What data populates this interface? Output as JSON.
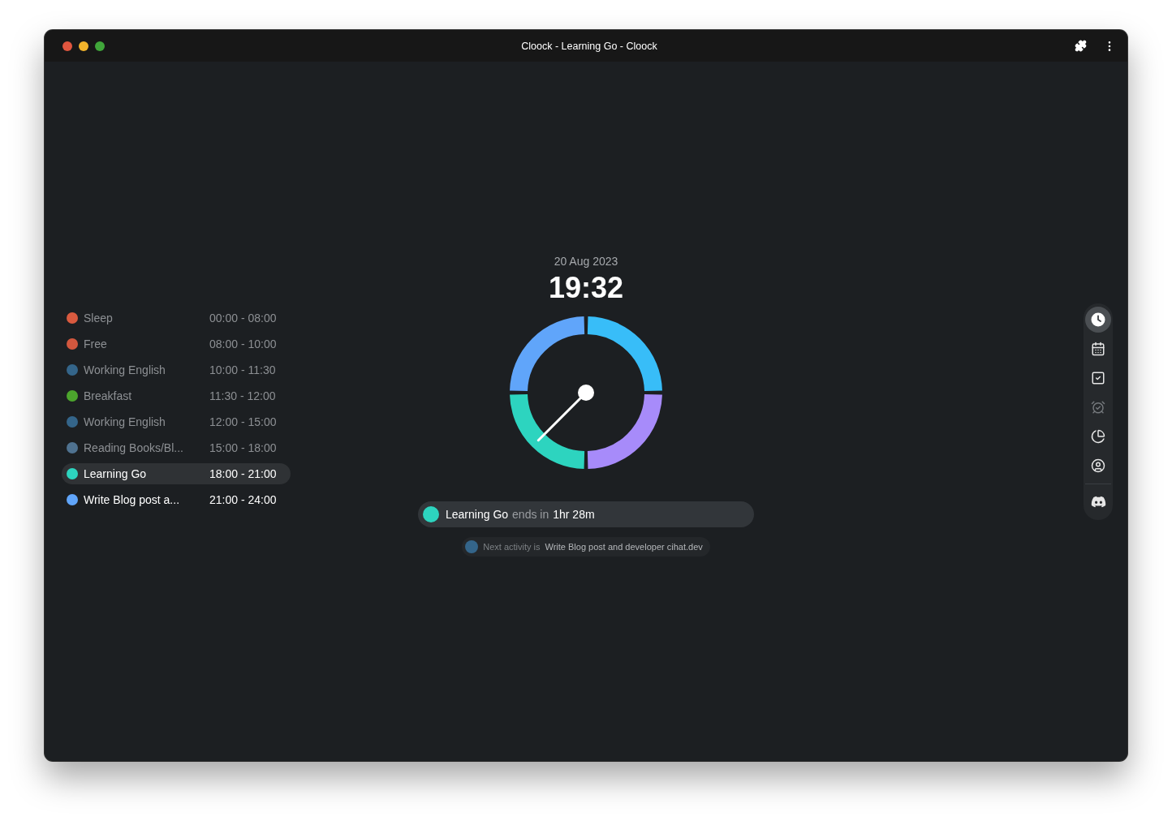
{
  "window": {
    "title": "Cloock - Learning Go - Cloock"
  },
  "activities": [
    {
      "name": "Sleep",
      "time": "00:00 - 08:00",
      "color": "#d95a3f",
      "done": true,
      "selected": false
    },
    {
      "name": "Free",
      "time": "08:00 - 10:00",
      "color": "#d2573e",
      "done": true,
      "selected": false
    },
    {
      "name": "Working English",
      "time": "10:00 - 11:30",
      "color": "#34658a",
      "done": true,
      "selected": false
    },
    {
      "name": "Breakfast",
      "time": "11:30 - 12:00",
      "color": "#4ca52d",
      "done": true,
      "selected": false
    },
    {
      "name": "Working English",
      "time": "12:00 - 15:00",
      "color": "#34658a",
      "done": true,
      "selected": false
    },
    {
      "name": "Reading Books/Bl...",
      "time": "15:00 - 18:00",
      "color": "#4f7290",
      "done": true,
      "selected": false
    },
    {
      "name": "Learning Go",
      "time": "18:00 - 21:00",
      "color": "#2dd4bf",
      "done": false,
      "selected": true
    },
    {
      "name": "Write Blog post a...",
      "time": "21:00 - 24:00",
      "color": "#60a5fa",
      "done": false,
      "selected": false
    }
  ],
  "clock": {
    "date": "20 Aug 2023",
    "time": "19:32"
  },
  "status": {
    "activity": "Learning Go",
    "connector": "ends in",
    "remaining": "1hr 28m",
    "color": "#2dd4bf"
  },
  "next": {
    "label": "Next activity is",
    "activity": "Write Blog post and developer cihat.dev",
    "color": "#34658a"
  },
  "nav": [
    {
      "kind": "clock",
      "selected": true,
      "disabled": false
    },
    {
      "kind": "calendar",
      "selected": false,
      "disabled": false
    },
    {
      "kind": "todo",
      "selected": false,
      "disabled": false
    },
    {
      "kind": "alarm",
      "selected": false,
      "disabled": true
    },
    {
      "kind": "stats",
      "selected": false,
      "disabled": false
    },
    {
      "kind": "profile",
      "selected": false,
      "disabled": false
    },
    {
      "kind": "discord",
      "selected": false,
      "disabled": false
    }
  ]
}
